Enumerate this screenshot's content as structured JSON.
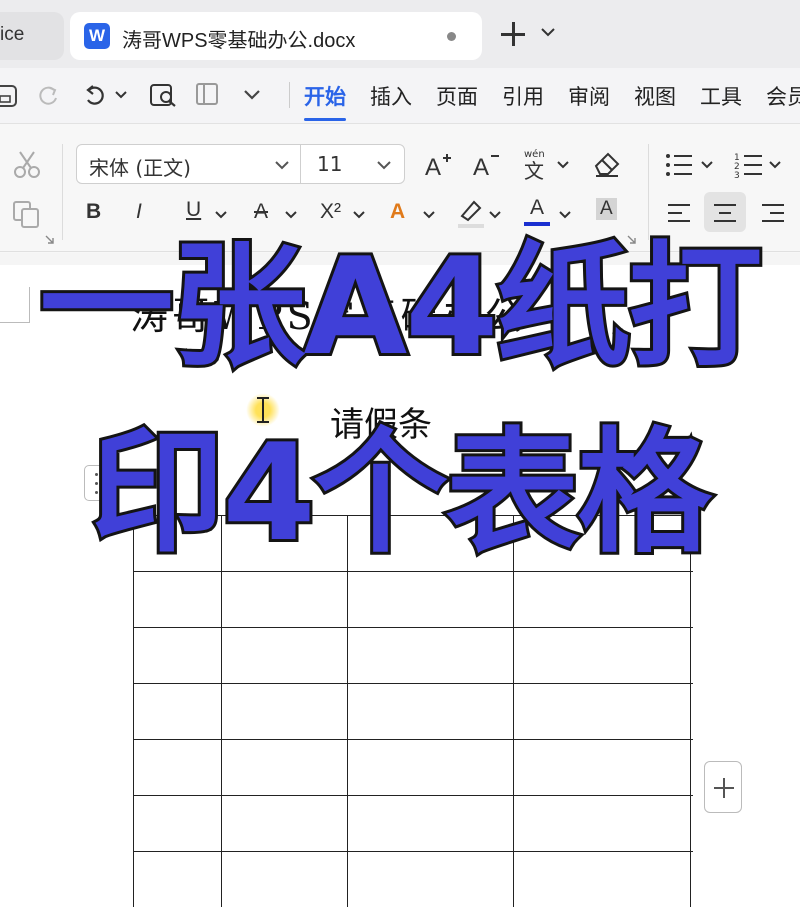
{
  "tabs": {
    "previous_tab_label": "ice",
    "active_tab_title": "涛哥WPS零基础办公.docx",
    "app_logo_letter": "W"
  },
  "menu": {
    "tabs": [
      "开始",
      "插入",
      "页面",
      "引用",
      "审阅",
      "视图",
      "工具",
      "会员"
    ],
    "active_tab": "开始"
  },
  "ribbon": {
    "font_name": "宋体 (正文)",
    "font_size": "11",
    "bold": "B",
    "italic": "I",
    "underline": "U",
    "strikethrough": "A",
    "superscript": "X²",
    "highlight_letter": "A",
    "font_color_letter": "A",
    "char_shading_letter": "A",
    "font_color_accent": "#1a2fd0"
  },
  "document": {
    "title": "涛哥WPS零基础办公",
    "subtitle": "请假条",
    "table_rows": 7
  },
  "overlay": {
    "line1": "一张A4纸打",
    "line2": "印4个表格",
    "fill_color": "#4040d8"
  }
}
